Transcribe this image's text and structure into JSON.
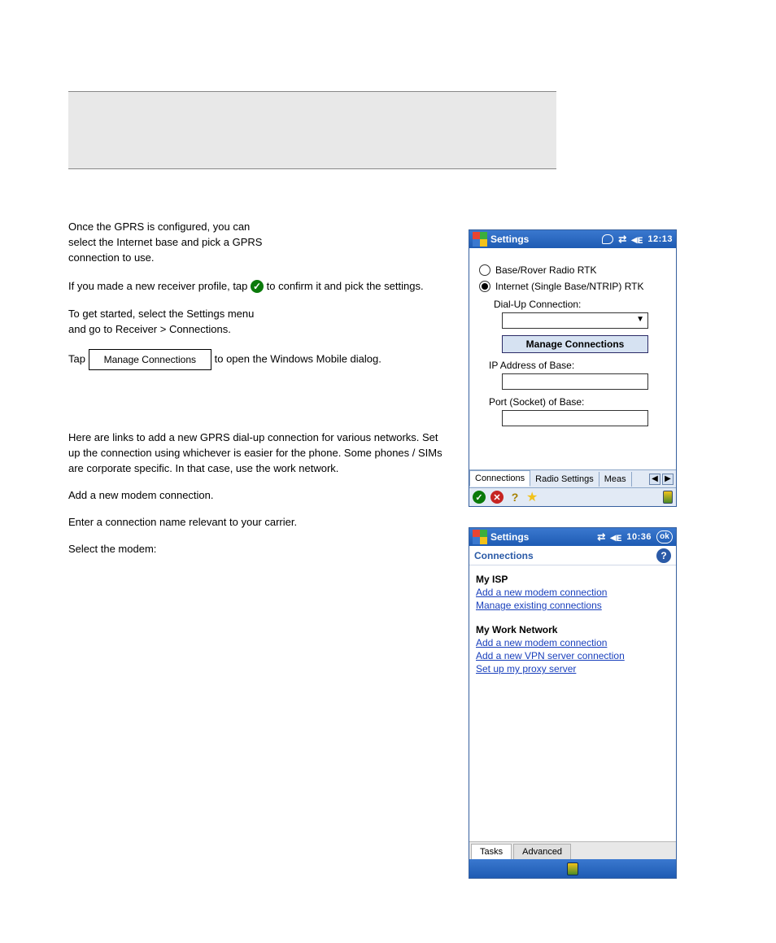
{
  "header_box": "",
  "left_text": {
    "line1": "Once the GPRS is configured, you can",
    "line2": "select the Internet base and pick a GPRS",
    "line3": "connection to use.",
    "para2_a": "If you made a new receiver profile, tap",
    "para2_b": "to confirm it and pick the settings.",
    "para3_a": "To get started, select the Settings menu",
    "para3_b": "and go to Receiver > Connections.",
    "btn_label": "Manage Connections",
    "para4_a": "Tap ",
    "para4_b": " to open the Windows Mobile dialog.",
    "connections_para1": "Here are links to add a new GPRS dial-up connection for various networks. Set up the connection using whichever is easier for the phone. Some phones / SIMs are corporate specific. In that case, use the work network.",
    "connections_para2": "Add a new modem connection.",
    "connections_para3": "Enter a connection name relevant to your carrier.",
    "connections_last": "Select the modem:"
  },
  "shot1": {
    "title": "Settings",
    "time": "12:13",
    "radio1": "Base/Rover Radio RTK",
    "radio2": "Internet (Single Base/NTRIP) RTK",
    "dialup_label": "Dial-Up Connection:",
    "manage_btn": "Manage Connections",
    "ip_label": "IP Address of Base:",
    "port_label": "Port (Socket) of Base:",
    "tab1": "Connections",
    "tab2": "Radio Settings",
    "tab3": "Meas"
  },
  "shot2": {
    "title": "Settings",
    "time": "10:36",
    "ok": "ok",
    "subheader": "Connections",
    "group1_title": "My ISP",
    "group1_link1": "Add a new modem connection",
    "group1_link2": "Manage existing connections",
    "group2_title": "My Work Network",
    "group2_link1": "Add a new modem connection",
    "group2_link2": "Add a new VPN server connection",
    "group2_link3": "Set up my proxy server",
    "tab1": "Tasks",
    "tab2": "Advanced"
  }
}
